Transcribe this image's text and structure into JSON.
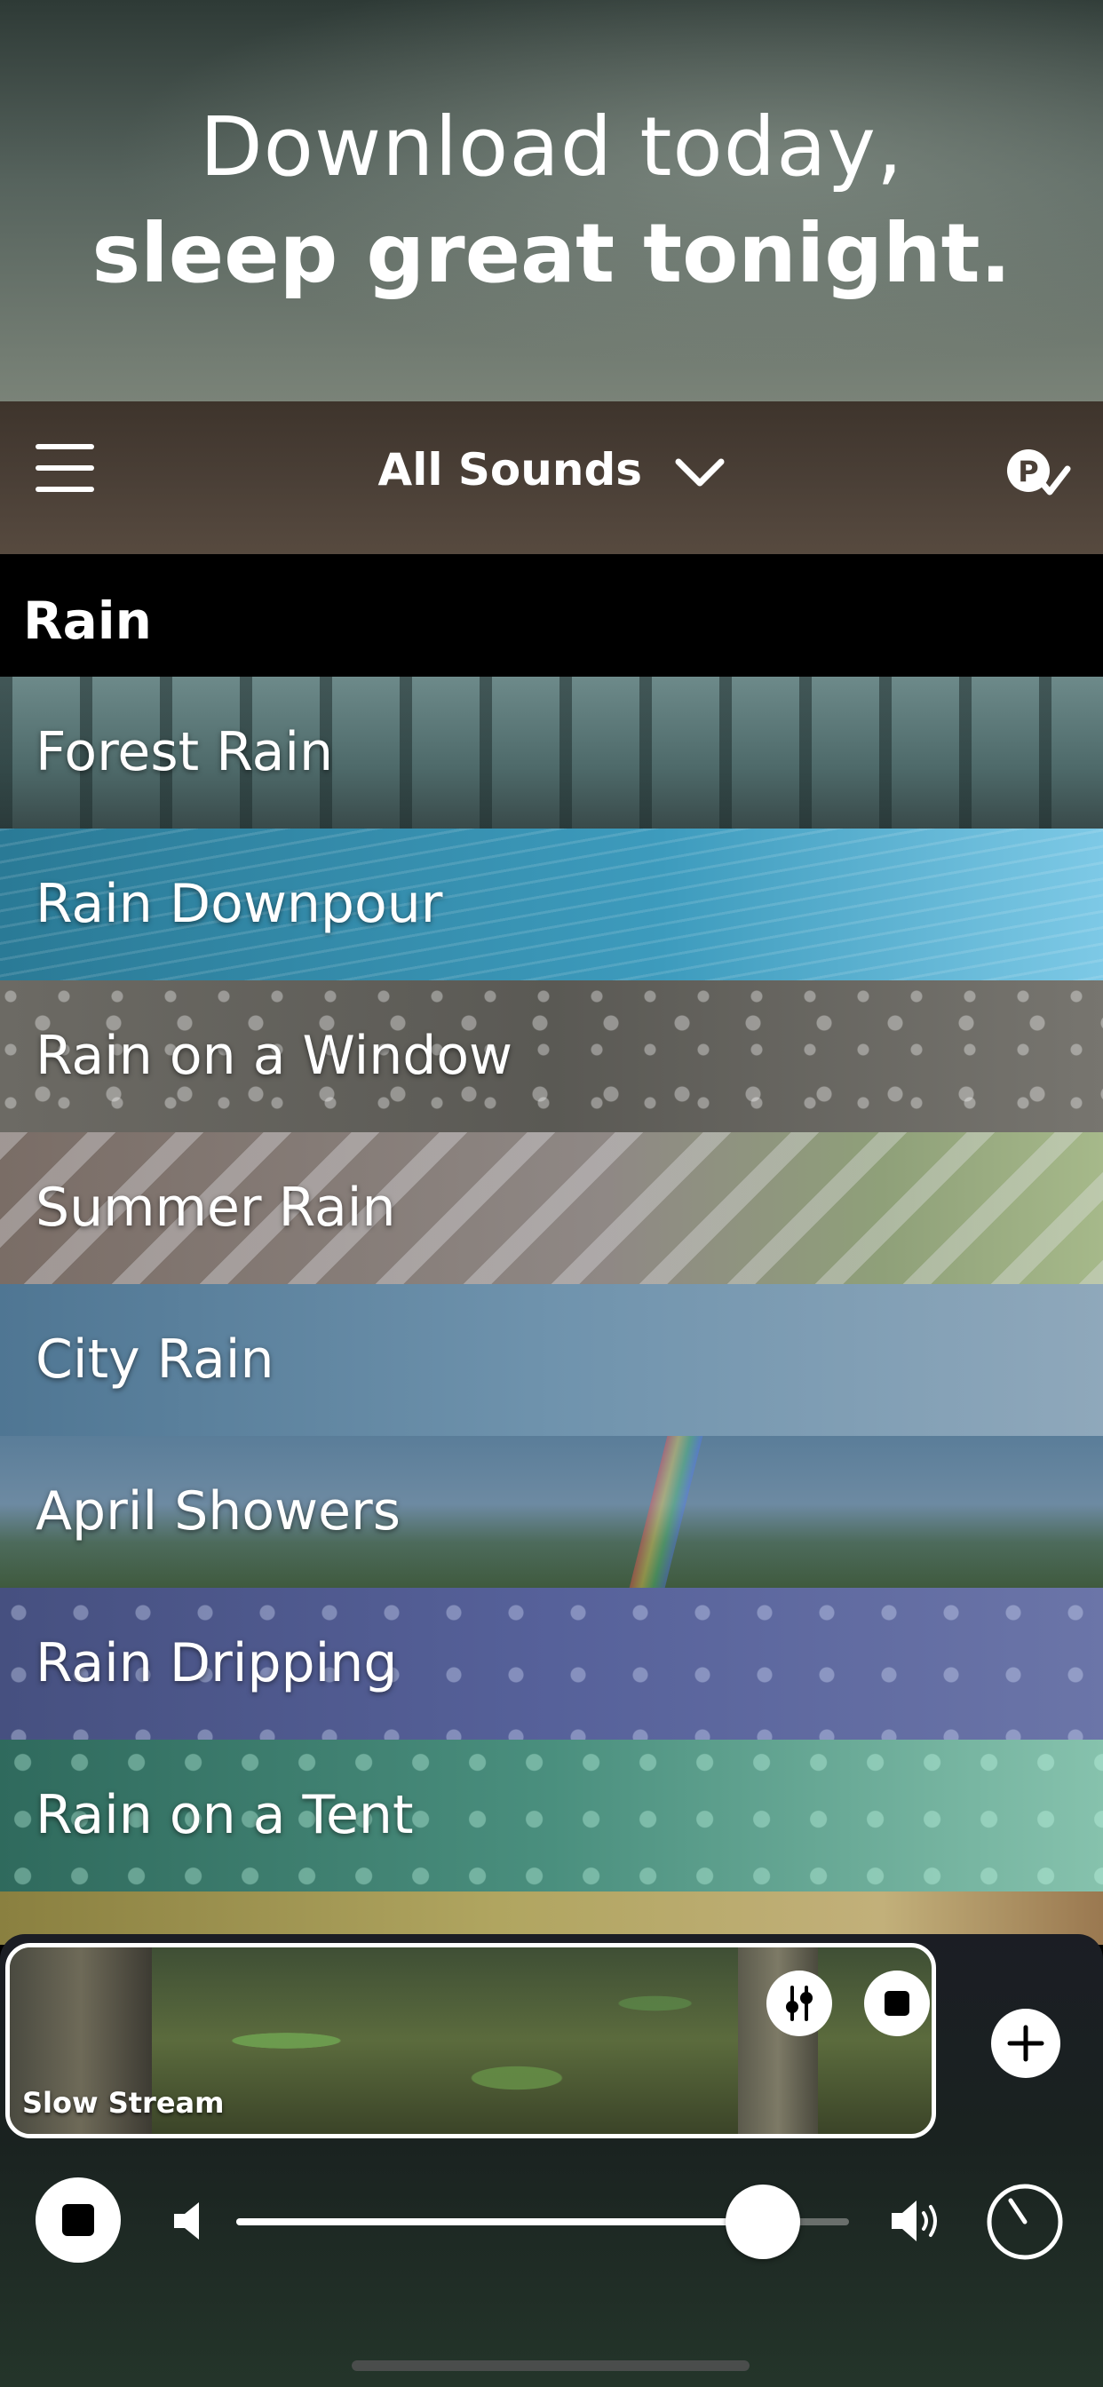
{
  "promo": {
    "line1": "Download today,",
    "line2": "sleep great tonight."
  },
  "navbar": {
    "title": "All Sounds",
    "menu_icon": "hamburger-menu-icon",
    "title_dropdown_icon": "chevron-down-icon",
    "right_icon": "p-check-icon"
  },
  "section": {
    "title": "Rain"
  },
  "sounds": [
    {
      "label": "Forest Rain"
    },
    {
      "label": "Rain Downpour"
    },
    {
      "label": "Rain on a Window"
    },
    {
      "label": "Summer Rain"
    },
    {
      "label": "City Rain"
    },
    {
      "label": "April Showers"
    },
    {
      "label": "Rain Dripping"
    },
    {
      "label": "Rain on a Tent"
    }
  ],
  "player": {
    "now_playing": {
      "label": "Slow Stream",
      "mixer_icon": "sliders-icon",
      "stop_icon": "stop-icon"
    },
    "add_icon": "plus-icon",
    "master_stop_icon": "stop-icon",
    "volume": {
      "low_icon": "speaker-low-icon",
      "high_icon": "speaker-high-icon",
      "level": 0.86
    },
    "timer_icon": "timer-icon"
  },
  "colors": {
    "navbar": "#4b4037",
    "accent": "#ffffff",
    "player_bg": "#1a2220"
  }
}
